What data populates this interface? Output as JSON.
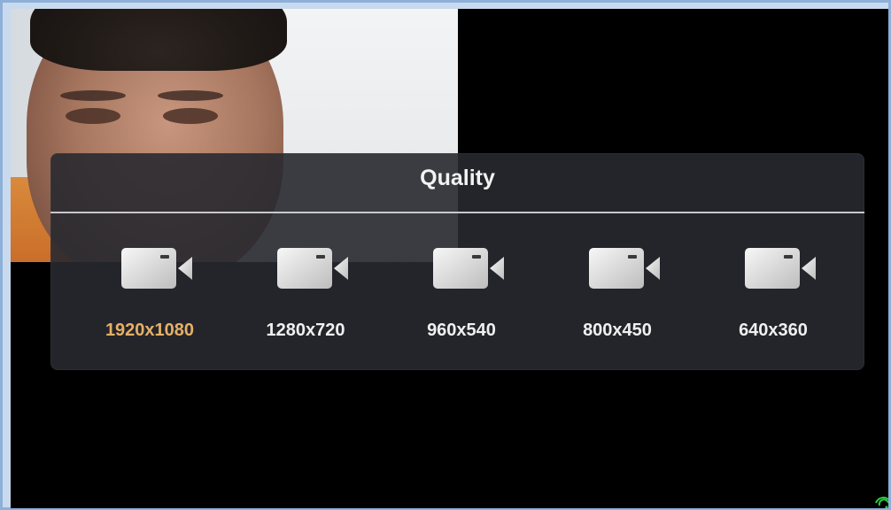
{
  "panel": {
    "title": "Quality",
    "selected_label_color": "#e6b066",
    "options": [
      {
        "label": "1920x1080",
        "selected": true
      },
      {
        "label": "1280x720",
        "selected": false
      },
      {
        "label": "960x540",
        "selected": false
      },
      {
        "label": "800x450",
        "selected": false
      },
      {
        "label": "640x360",
        "selected": false
      }
    ],
    "option_icon": "video-camera-icon"
  },
  "status": {
    "signal_icon": "wifi-signal-icon",
    "signal_color": "#2ecc40"
  }
}
